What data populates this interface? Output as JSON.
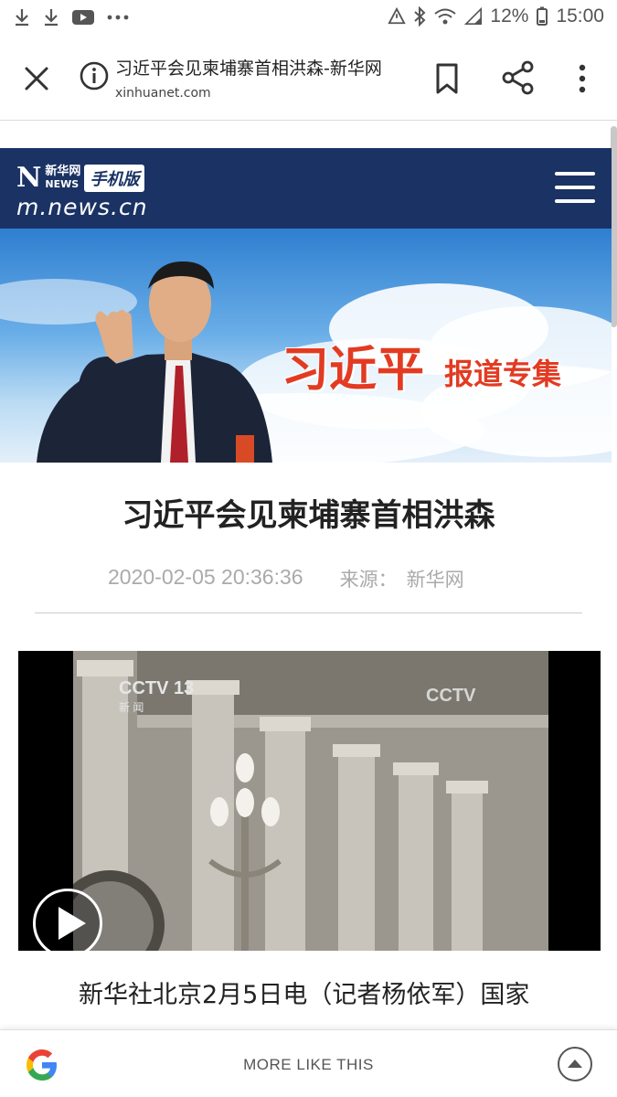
{
  "status_bar": {
    "battery_percent": "12%",
    "time": "15:00",
    "icons": [
      "download-icon",
      "download-icon",
      "youtube-icon",
      "more-icon",
      "data-saver-icon",
      "bluetooth-icon",
      "wifi-icon",
      "signal-icon",
      "battery-icon"
    ]
  },
  "browser": {
    "page_title": "习近平会见柬埔寨首相洪森-新华网",
    "url": "xinhuanet.com"
  },
  "site_header": {
    "logo_text": "新华网",
    "logo_letters": "NEWS",
    "logo_badge": "手机版",
    "logo_url": "m.news.cn"
  },
  "banner": {
    "headline_main": "习近平",
    "headline_sub": "报道专集"
  },
  "article": {
    "title": "习近平会见柬埔寨首相洪森",
    "datetime": "2020-02-05 20:36:36",
    "source_label": "来源：",
    "source_value": "新华网",
    "lead": "新华社北京2月5日电（记者杨依军）国家"
  },
  "video": {
    "channel_logo": "CCTV 13",
    "channel_sub": "新 闻",
    "watermark": "CCTV"
  },
  "bottom_bar": {
    "label": "MORE LIKE THIS"
  },
  "colors": {
    "header_navy": "#1a3264",
    "banner_red": "#e23b22",
    "meta_gray": "#aaaaaa"
  }
}
